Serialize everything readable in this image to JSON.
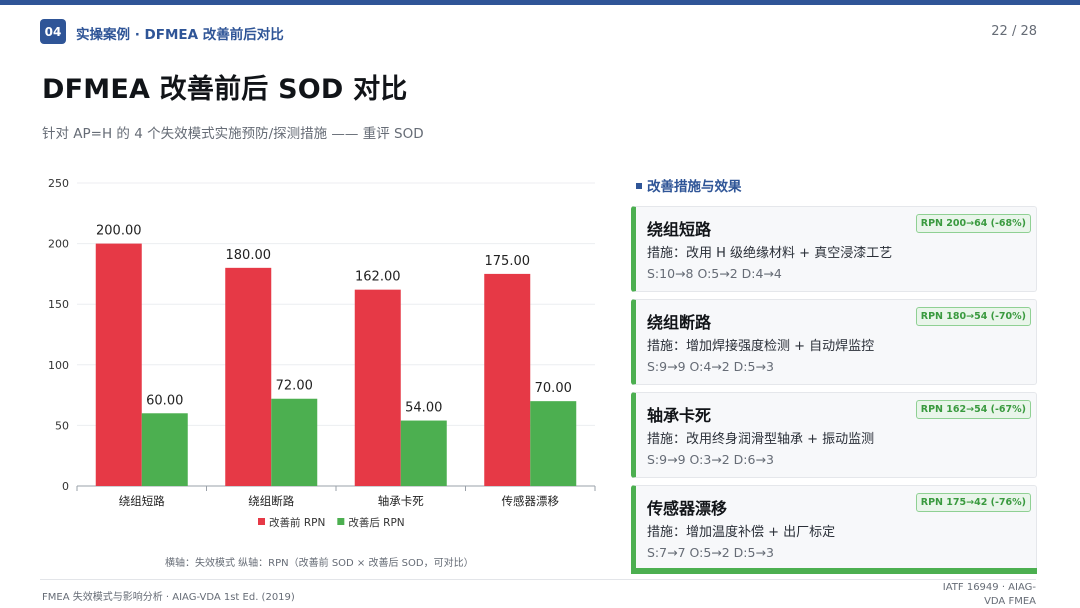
{
  "header": {
    "section_number": "04",
    "section_title": "实操案例 · DFMEA 改善前后对比",
    "page_indicator": "22 / 28"
  },
  "title": "DFMEA 改善前后 SOD 对比",
  "subtitle": "针对 AP=H 的 4 个失效模式实施预防/探测措施 —— 重评 SOD",
  "chart_data": {
    "type": "bar",
    "categories": [
      "绕组短路",
      "绕组断路",
      "轴承卡死",
      "传感器漂移"
    ],
    "series": [
      {
        "name": "改善前 RPN",
        "values": [
          200,
          180,
          162,
          175
        ],
        "color": "#e63946"
      },
      {
        "name": "改善后 RPN",
        "values": [
          60,
          72,
          54,
          70
        ],
        "color": "#4caf50"
      }
    ],
    "ylim": [
      0,
      250
    ],
    "yticks": [
      0,
      50,
      100,
      150,
      200,
      250
    ],
    "grid": true,
    "legend": "bottom",
    "data_labels": true,
    "note": "横轴：失效模式    纵轴：RPN（改善前 SOD × 改善后 SOD，可对比）"
  },
  "panel": {
    "title": "改善措施与效果",
    "accent": "#4caf50",
    "cards": [
      {
        "title": "绕组短路",
        "measure": "措施：改用 H 级绝缘材料 + 真空浸漆工艺",
        "sod": "S:10→8   O:5→2   D:4→4",
        "tag": "RPN 200→64 (-68%)"
      },
      {
        "title": "绕组断路",
        "measure": "措施：增加焊接强度检测 + 自动焊监控",
        "sod": "S:9→9   O:4→2   D:5→3",
        "tag": "RPN 180→54 (-70%)"
      },
      {
        "title": "轴承卡死",
        "measure": "措施：改用终身润滑型轴承 + 振动监测",
        "sod": "S:9→9   O:3→2   D:6→3",
        "tag": "RPN 162→54 (-67%)"
      },
      {
        "title": "传感器漂移",
        "measure": "措施：增加温度补偿 + 出厂标定",
        "sod": "S:7→7   O:5→2   D:5→3",
        "tag": "RPN 175→42 (-76%)"
      }
    ]
  },
  "footer": {
    "left": "FMEA 失效模式与影响分析 · AIAG-VDA 1st Ed. (2019)",
    "right": "IATF 16949 · AIAG-VDA FMEA"
  }
}
